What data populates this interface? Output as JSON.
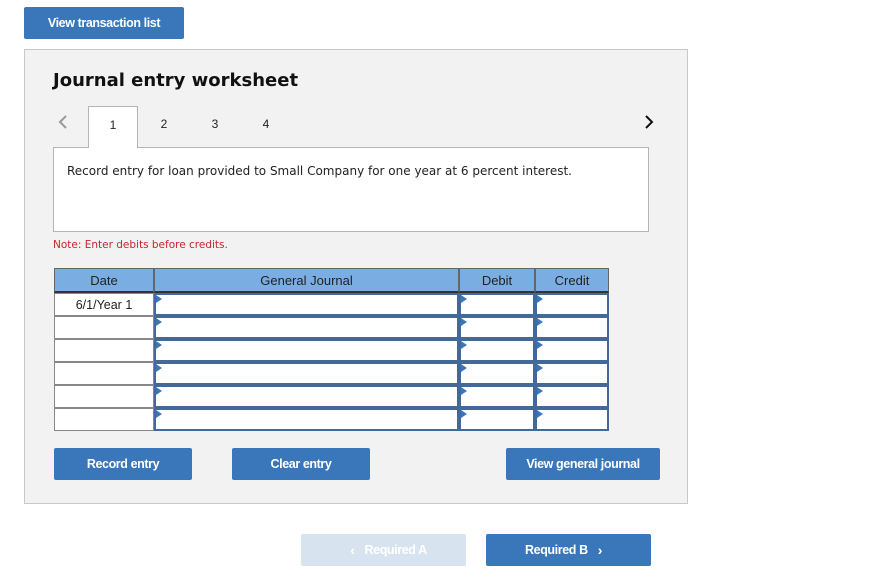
{
  "top_button": {
    "label": "View transaction list"
  },
  "worksheet": {
    "title": "Journal entry worksheet",
    "tabs": [
      "1",
      "2",
      "3",
      "4"
    ],
    "active_tab": "1",
    "prompt": "Record entry for loan provided to Small Company for one year at 6 percent interest.",
    "note": "Note: Enter debits before credits.",
    "table": {
      "headers": {
        "date": "Date",
        "general_journal": "General Journal",
        "debit": "Debit",
        "credit": "Credit"
      },
      "rows": [
        {
          "date": "6/1/Year 1",
          "account": "",
          "debit": "",
          "credit": ""
        },
        {
          "date": "",
          "account": "",
          "debit": "",
          "credit": ""
        },
        {
          "date": "",
          "account": "",
          "debit": "",
          "credit": ""
        },
        {
          "date": "",
          "account": "",
          "debit": "",
          "credit": ""
        },
        {
          "date": "",
          "account": "",
          "debit": "",
          "credit": ""
        },
        {
          "date": "",
          "account": "",
          "debit": "",
          "credit": ""
        }
      ]
    },
    "buttons": {
      "record": "Record entry",
      "clear": "Clear entry",
      "view_general_journal": "View general journal"
    }
  },
  "navigation": {
    "prev": {
      "label": "Required A",
      "icon": "chevron-left-icon",
      "disabled": true
    },
    "next": {
      "label": "Required B",
      "icon": "chevron-right-icon",
      "disabled": false
    }
  },
  "colors": {
    "primary_button": "#3a77ba",
    "disabled_button": "#d8e3f0",
    "table_header": "#7aaee3",
    "note_text": "#c0282d",
    "panel_bg": "#f2f2f2"
  }
}
